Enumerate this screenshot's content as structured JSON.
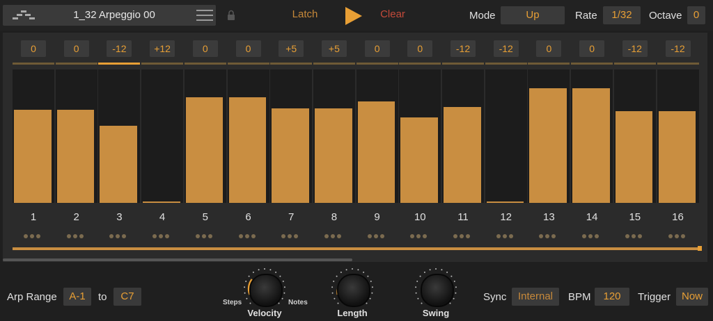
{
  "header": {
    "preset_name": "1_32 Arpeggio 00",
    "latch_label": "Latch",
    "clear_label": "Clear",
    "mode_label": "Mode",
    "mode_value": "Up",
    "rate_label": "Rate",
    "rate_value": "1/32",
    "octave_label": "Octave",
    "octave_value": "0"
  },
  "steps": [
    {
      "number": "1",
      "pitch": "0",
      "velocity": 0.7,
      "active": false
    },
    {
      "number": "2",
      "pitch": "0",
      "velocity": 0.7,
      "active": false
    },
    {
      "number": "3",
      "pitch": "-12",
      "velocity": 0.58,
      "active": true
    },
    {
      "number": "4",
      "pitch": "+12",
      "velocity": 0.01,
      "active": false
    },
    {
      "number": "5",
      "pitch": "0",
      "velocity": 0.79,
      "active": false
    },
    {
      "number": "6",
      "pitch": "0",
      "velocity": 0.79,
      "active": false
    },
    {
      "number": "7",
      "pitch": "+5",
      "velocity": 0.71,
      "active": false
    },
    {
      "number": "8",
      "pitch": "+5",
      "velocity": 0.71,
      "active": false
    },
    {
      "number": "9",
      "pitch": "0",
      "velocity": 0.76,
      "active": false
    },
    {
      "number": "10",
      "pitch": "0",
      "velocity": 0.64,
      "active": false
    },
    {
      "number": "11",
      "pitch": "-12",
      "velocity": 0.72,
      "active": false
    },
    {
      "number": "12",
      "pitch": "-12",
      "velocity": 0.01,
      "active": false
    },
    {
      "number": "13",
      "pitch": "0",
      "velocity": 0.86,
      "active": false
    },
    {
      "number": "14",
      "pitch": "0",
      "velocity": 0.86,
      "active": false
    },
    {
      "number": "15",
      "pitch": "-12",
      "velocity": 0.69,
      "active": false
    },
    {
      "number": "16",
      "pitch": "-12",
      "velocity": 0.69,
      "active": false
    }
  ],
  "footer": {
    "arp_range_label": "Arp Range",
    "range_from": "A-1",
    "to_label": "to",
    "range_to": "C7",
    "velocity_label": "Velocity",
    "steps_label": "Steps",
    "notes_label": "Notes",
    "length_label": "Length",
    "swing_label": "Swing",
    "sync_label": "Sync",
    "sync_value": "Internal",
    "bpm_label": "BPM",
    "bpm_value": "120",
    "trigger_label": "Trigger",
    "trigger_value": "Now"
  },
  "colors": {
    "accent": "#e89f35",
    "bar": "#c98e41",
    "clear": "#c44a3a"
  }
}
